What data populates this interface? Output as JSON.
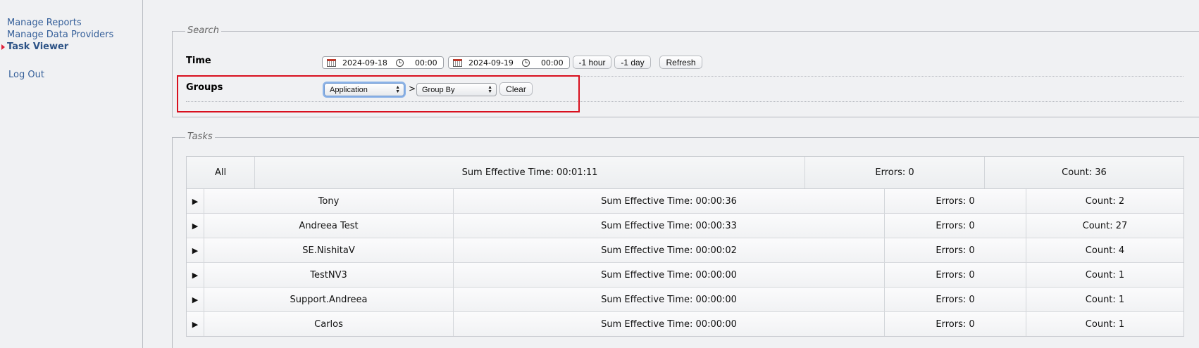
{
  "sidebar": {
    "items": [
      {
        "label": "Manage Reports"
      },
      {
        "label": "Manage Data Providers"
      },
      {
        "label": "Task Viewer"
      },
      {
        "label": "Log Out"
      }
    ]
  },
  "search": {
    "legend": "Search",
    "time_label": "Time",
    "from_date": "2024-09-18",
    "from_time": "00:00",
    "to_date": "2024-09-19",
    "to_time": "00:00",
    "minus_hour_label": "-1 hour",
    "minus_day_label": "-1 day",
    "refresh_label": "Refresh",
    "groups_label": "Groups",
    "group_primary": "Application",
    "group_separator": ">",
    "group_secondary": "Group By",
    "clear_label": "Clear"
  },
  "tasks": {
    "legend": "Tasks",
    "summary": {
      "name": "All",
      "time": "Sum Effective Time: 00:01:11",
      "errors": "Errors: 0",
      "count": "Count: 36"
    },
    "expander_glyph": "▶",
    "rows": [
      {
        "name": "Tony",
        "time": "Sum Effective Time: 00:00:36",
        "errors": "Errors: 0",
        "count": "Count: 2"
      },
      {
        "name": "Andreea Test",
        "time": "Sum Effective Time: 00:00:33",
        "errors": "Errors: 0",
        "count": "Count: 27"
      },
      {
        "name": "SE.NishitaV",
        "time": "Sum Effective Time: 00:00:02",
        "errors": "Errors: 0",
        "count": "Count: 4"
      },
      {
        "name": "TestNV3",
        "time": "Sum Effective Time: 00:00:00",
        "errors": "Errors: 0",
        "count": "Count: 1"
      },
      {
        "name": "Support.Andreea",
        "time": "Sum Effective Time: 00:00:00",
        "errors": "Errors: 0",
        "count": "Count: 1"
      },
      {
        "name": "Carlos",
        "time": "Sum Effective Time: 00:00:00",
        "errors": "Errors: 0",
        "count": "Count: 1"
      }
    ]
  },
  "colors": {
    "nav_link": "#36609a",
    "active_marker": "#e0203a",
    "highlight": "#d8101e"
  }
}
